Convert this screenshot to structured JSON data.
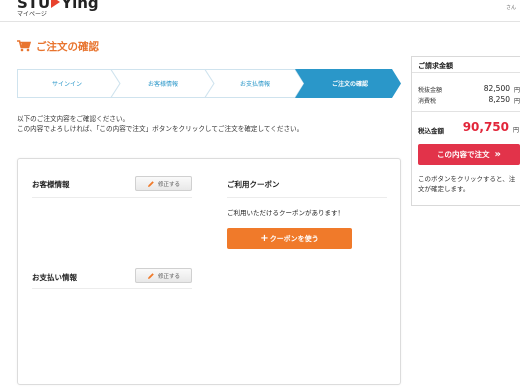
{
  "header": {
    "logo_left": "STU",
    "logo_right": "Ying",
    "logo_sub": "マイページ",
    "user_label": "さん"
  },
  "page": {
    "title": "ご注文の確認"
  },
  "steps": [
    {
      "label": "サインイン",
      "active": false
    },
    {
      "label": "お客様情報",
      "active": false
    },
    {
      "label": "お支払情報",
      "active": false
    },
    {
      "label": "ご注文の確認",
      "active": true
    }
  ],
  "intro": {
    "line1": "以下のご注文内容をご確認ください。",
    "line2": "この内容でよろしければ、「この内容で注文」ボタンをクリックしてご注文を確定してください。"
  },
  "customer": {
    "title": "お客様情報",
    "edit_label": "修正する"
  },
  "payment": {
    "title": "お支払い情報",
    "edit_label": "修正する"
  },
  "coupon": {
    "title": "ご利用クーポン",
    "message": "ご利用いただけるクーポンがあります！",
    "button_label": "クーポンを使う"
  },
  "summary": {
    "title": "ご請求金額",
    "rows": [
      {
        "label": "税抜金額",
        "value": "82,500",
        "unit": "円"
      },
      {
        "label": "消費税",
        "value": "8,250",
        "unit": "円"
      }
    ],
    "total_label": "税込金額",
    "total_value": "90,750",
    "total_unit": "円",
    "confirm_label": "この内容で注文",
    "confirm_arrows": "»",
    "note": "このボタンをクリックすると、注文が確定します。"
  },
  "colors": {
    "accent_orange": "#f07a2a",
    "step_active": "#2a97c9",
    "confirm_red": "#e2334a",
    "total_red": "#e2263a"
  },
  "icons": {
    "title": "cart-icon",
    "edit": "pencil-icon",
    "coupon": "plus-icon",
    "confirm": "double-chevron-right-icon"
  }
}
